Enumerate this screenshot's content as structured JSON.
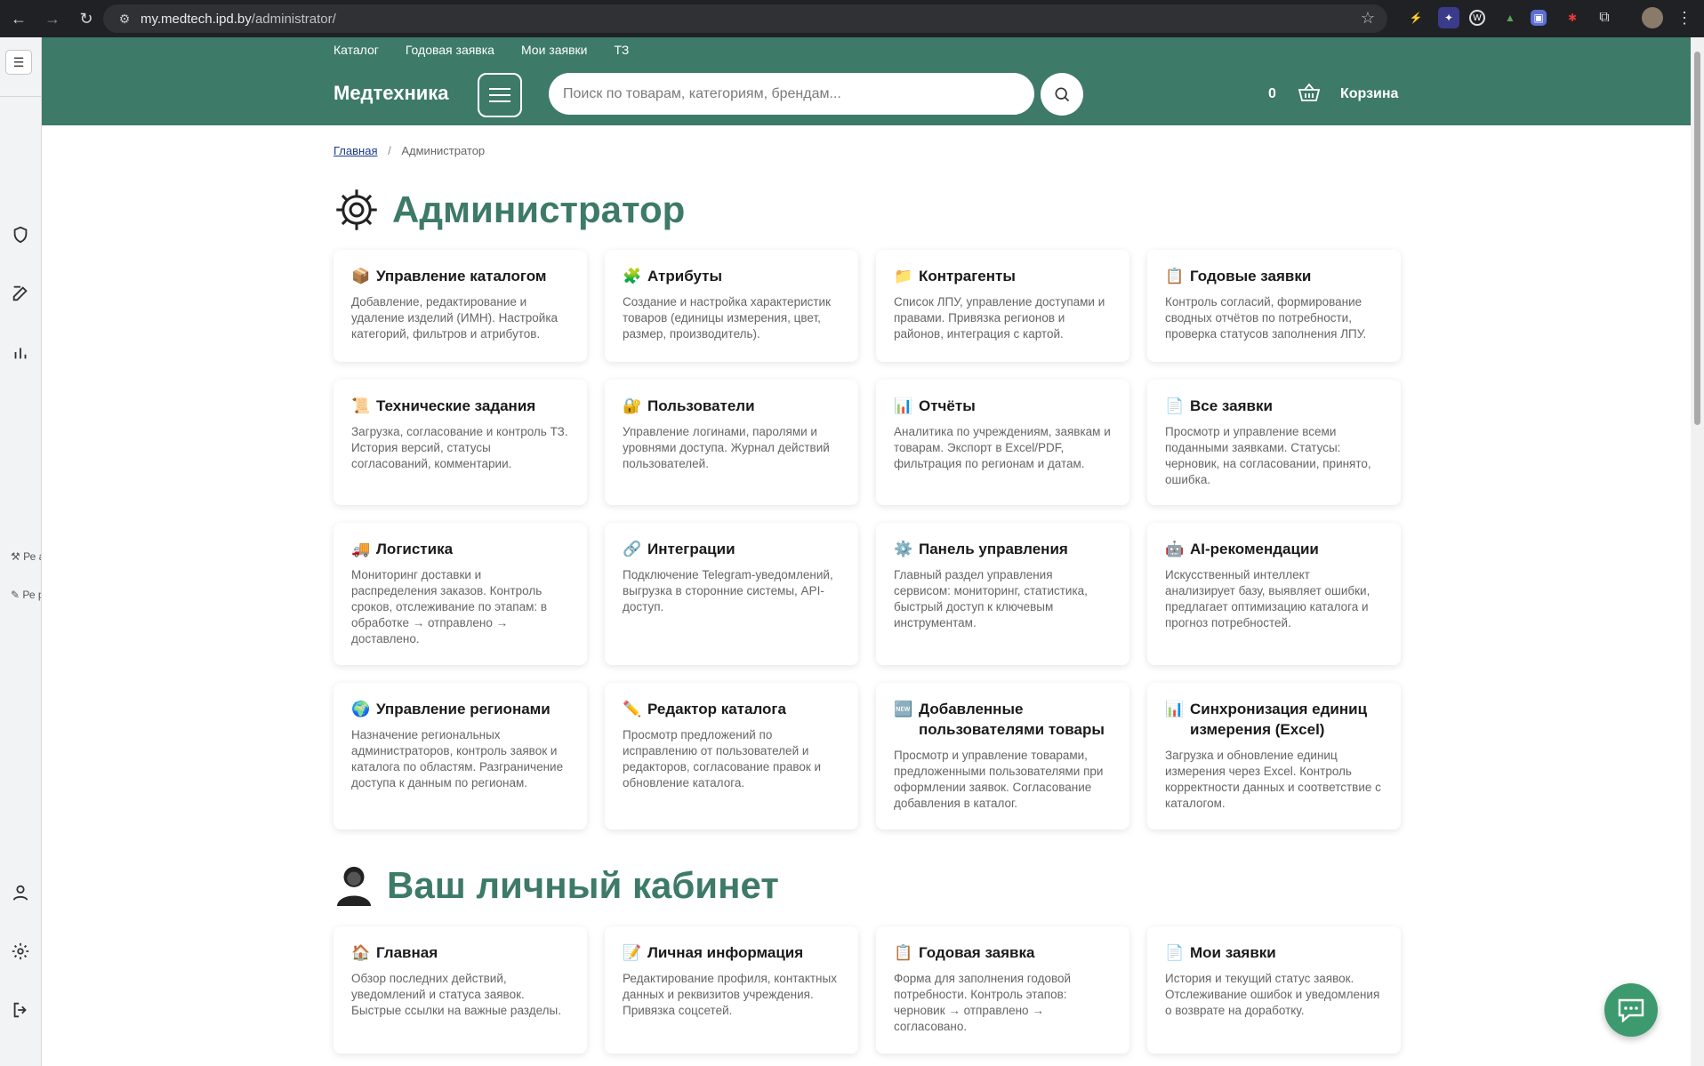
{
  "browser": {
    "url_host": "my.medtech.ipd.by",
    "url_path": "/administrator/"
  },
  "sidebar_rail": {
    "text1": "Ре адм",
    "text2": "Ре ре"
  },
  "header": {
    "topnav": [
      "Каталог",
      "Годовая заявка",
      "Мои заявки",
      "ТЗ"
    ],
    "brand": "Медтехника",
    "search_placeholder": "Поиск по товарам, категориям, брендам...",
    "cart_count": "0",
    "cart_label": "Корзина"
  },
  "breadcrumb": {
    "home": "Главная",
    "current": "Администратор"
  },
  "admin": {
    "title": "Администратор",
    "cards": [
      {
        "icon": "📦",
        "title": "Управление каталогом",
        "desc": "Добавление, редактирование и удаление изделий (ИМН). Настройка категорий, фильтров и атрибутов."
      },
      {
        "icon": "🧩",
        "title": "Атрибуты",
        "desc": "Создание и настройка характеристик товаров (единицы измерения, цвет, размер, производитель)."
      },
      {
        "icon": "📁",
        "title": "Контрагенты",
        "desc": "Список ЛПУ, управление доступами и правами. Привязка регионов и районов, интеграция с картой."
      },
      {
        "icon": "📋",
        "title": "Годовые заявки",
        "desc": "Контроль согласий, формирование сводных отчётов по потребности, проверка статусов заполнения ЛПУ."
      },
      {
        "icon": "📜",
        "title": "Технические задания",
        "desc": "Загрузка, согласование и контроль ТЗ. История версий, статусы согласований, комментарии."
      },
      {
        "icon": "🔐",
        "title": "Пользователи",
        "desc": "Управление логинами, паролями и уровнями доступа. Журнал действий пользователей."
      },
      {
        "icon": "📊",
        "title": "Отчёты",
        "desc": "Аналитика по учреждениям, заявкам и товарам. Экспорт в Excel/PDF, фильтрация по регионам и датам."
      },
      {
        "icon": "📄",
        "title": "Все заявки",
        "desc": "Просмотр и управление всеми поданными заявками. Статусы: черновик, на согласовании, принято, ошибка."
      },
      {
        "icon": "🚚",
        "title": "Логистика",
        "desc": "Мониторинг доставки и распределения заказов. Контроль сроков, отслеживание по этапам: в обработке → отправлено → доставлено."
      },
      {
        "icon": "🔗",
        "title": "Интеграции",
        "desc": "Подключение Telegram-уведомлений, выгрузка в сторонние системы, API-доступ."
      },
      {
        "icon": "⚙️",
        "title": "Панель управления",
        "desc": "Главный раздел управления сервисом: мониторинг, статистика, быстрый доступ к ключевым инструментам."
      },
      {
        "icon": "🤖",
        "title": "AI-рекомендации",
        "desc": "Искусственный интеллект анализирует базу, выявляет ошибки, предлагает оптимизацию каталога и прогноз потребностей."
      },
      {
        "icon": "🌍",
        "title": "Управление регионами",
        "desc": "Назначение региональных администраторов, контроль заявок и каталога по областям. Разграничение доступа к данным по регионам."
      },
      {
        "icon": "✏️",
        "title": "Редактор каталога",
        "desc": "Просмотр предложений по исправлению от пользователей и редакторов, согласование правок и обновление каталога."
      },
      {
        "icon": "🆕",
        "title": "Добавленные пользователями товары",
        "desc": "Просмотр и управление товарами, предложенными пользователями при оформлении заявок. Согласование добавления в каталог."
      },
      {
        "icon": "📊",
        "title": "Синхронизация единиц измерения (Excel)",
        "desc": "Загрузка и обновление единиц измерения через Excel. Контроль корректности данных и соответствие с каталогом."
      }
    ]
  },
  "personal": {
    "title": "Ваш личный кабинет",
    "cards": [
      {
        "icon": "🏠",
        "title": "Главная",
        "desc": "Обзор последних действий, уведомлений и статуса заявок. Быстрые ссылки на важные разделы."
      },
      {
        "icon": "📝",
        "title": "Личная информация",
        "desc": "Редактирование профиля, контактных данных и реквизитов учреждения. Привязка соцсетей."
      },
      {
        "icon": "📋",
        "title": "Годовая заявка",
        "desc": "Форма для заполнения годовой потребности. Контроль этапов: черновик → отправлено → согласовано."
      },
      {
        "icon": "📄",
        "title": "Мои заявки",
        "desc": "История и текущий статус заявок. Отслеживание ошибок и уведомления о возврате на доработку."
      }
    ]
  }
}
